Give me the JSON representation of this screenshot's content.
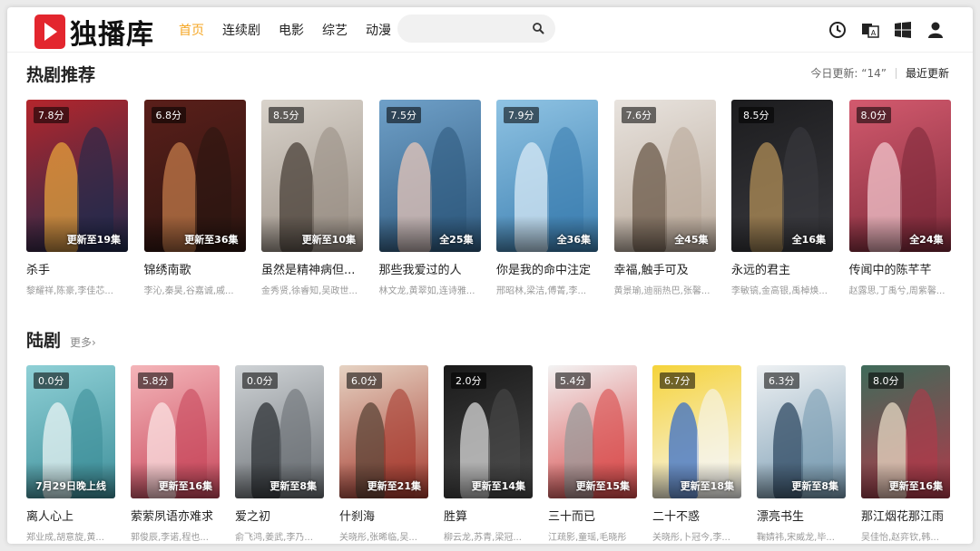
{
  "brand": {
    "name": "独播库",
    "color": "#e3262e"
  },
  "nav": [
    {
      "label": "首页",
      "active": true
    },
    {
      "label": "连续剧",
      "active": false
    },
    {
      "label": "电影",
      "active": false
    },
    {
      "label": "综艺",
      "active": false
    },
    {
      "label": "动漫",
      "active": false
    }
  ],
  "search": {
    "value": "",
    "placeholder": "",
    "icon": "search-icon"
  },
  "tools": [
    "history-icon",
    "language-icon",
    "windows-icon",
    "user-icon"
  ],
  "hot": {
    "title": "热剧推荐",
    "today_label": "今日更新: “14”",
    "latest_label": "最近更新",
    "items": [
      {
        "score": "7.8分",
        "episodes": "更新至19集",
        "title": "杀手",
        "cast": "黎耀祥,陈豪,李佳芯...",
        "colors": [
          "#b3262c",
          "#1f2a4d",
          "#e6a23c"
        ]
      },
      {
        "score": "6.8分",
        "episodes": "更新至36集",
        "title": "锦绣南歌",
        "cast": "李沁,秦昊,谷嘉诚,戚...",
        "colors": [
          "#5a1f1a",
          "#2b1510",
          "#c27a4a"
        ]
      },
      {
        "score": "8.5分",
        "episodes": "更新至10集",
        "title": "虽然是精神病但...",
        "cast": "金秀贤,徐睿知,吴政世...",
        "colors": [
          "#d9d3cb",
          "#9a8f85",
          "#4a4038"
        ]
      },
      {
        "score": "7.5分",
        "episodes": "全25集",
        "title": "那些我爱过的人",
        "cast": "林文龙,黄翠如,连诗雅...",
        "colors": [
          "#6fa0c8",
          "#2f5a7f",
          "#e7c5b8"
        ]
      },
      {
        "score": "7.9分",
        "episodes": "全36集",
        "title": "你是我的命中注定",
        "cast": "邢昭林,梁洁,傅菁,李...",
        "colors": [
          "#8fc3e3",
          "#3c7fb1",
          "#d8eaf5"
        ]
      },
      {
        "score": "7.6分",
        "episodes": "全45集",
        "title": "幸福,触手可及",
        "cast": "黄景瑜,迪丽热巴,张馨...",
        "colors": [
          "#e8e3de",
          "#b9a99a",
          "#6b5a4a"
        ]
      },
      {
        "score": "8.5分",
        "episodes": "全16集",
        "title": "永远的君主",
        "cast": "李敏镐,金高银,禹棹焕...",
        "colors": [
          "#1c1c1e",
          "#3a3a3f",
          "#b08d57"
        ]
      },
      {
        "score": "8.0分",
        "episodes": "全24集",
        "title": "传闻中的陈芊芊",
        "cast": "赵露思,丁禹兮,周紫馨...",
        "colors": [
          "#d35a6e",
          "#7e2a3a",
          "#f2c6cc"
        ]
      }
    ]
  },
  "lu": {
    "title": "陆剧",
    "more_label": "更多›",
    "items": [
      {
        "score": "0.0分",
        "episodes": "7月29日晚上线",
        "title": "离人心上",
        "cast": "郑业成,胡意旋,黄...",
        "colors": [
          "#8fd0d6",
          "#3e8f9a",
          "#e9f4f4"
        ],
        "center": true
      },
      {
        "score": "5.8分",
        "episodes": "更新至16集",
        "title": "萦萦夙语亦难求",
        "cast": "郭俊辰,李诺,程也...",
        "colors": [
          "#f4b5b9",
          "#c8475b",
          "#fbe3e3"
        ]
      },
      {
        "score": "0.0分",
        "episodes": "更新至8集",
        "title": "爱之初",
        "cast": "俞飞鸿,姜武,李乃...",
        "colors": [
          "#cfd3d6",
          "#6b7075",
          "#2e3236"
        ]
      },
      {
        "score": "6.0分",
        "episodes": "更新至21集",
        "title": "什刹海",
        "cast": "关晓彤,张晞临,吴...",
        "colors": [
          "#e6d3c3",
          "#a63a2e",
          "#5b4336"
        ]
      },
      {
        "score": "2.0分",
        "episodes": "更新至14集",
        "title": "胜算",
        "cast": "柳云龙,苏青,梁冠...",
        "colors": [
          "#1a1a1a",
          "#4a4a4a",
          "#d8d8d8"
        ]
      },
      {
        "score": "5.4分",
        "episodes": "更新至15集",
        "title": "三十而已",
        "cast": "江疏影,童瑶,毛晓彤",
        "colors": [
          "#f3f3f3",
          "#d84a4a",
          "#9a9a9a"
        ]
      },
      {
        "score": "6.7分",
        "episodes": "更新至18集",
        "title": "二十不惑",
        "cast": "关晓彤,卜冠今,李...",
        "colors": [
          "#f5d33a",
          "#f7f7f7",
          "#3a6fc8"
        ]
      },
      {
        "score": "6.3分",
        "episodes": "更新至8集",
        "title": "漂亮书生",
        "cast": "鞠婧祎,宋威龙,毕...",
        "colors": [
          "#eef1f3",
          "#7a9cb3",
          "#2f4a63"
        ]
      },
      {
        "score": "8.0分",
        "episodes": "更新至16集",
        "title": "那江烟花那江雨",
        "cast": "吴佳怡,赵弈钦,韩...",
        "colors": [
          "#3f6b5a",
          "#b1394a",
          "#e7d9c4"
        ]
      }
    ]
  }
}
